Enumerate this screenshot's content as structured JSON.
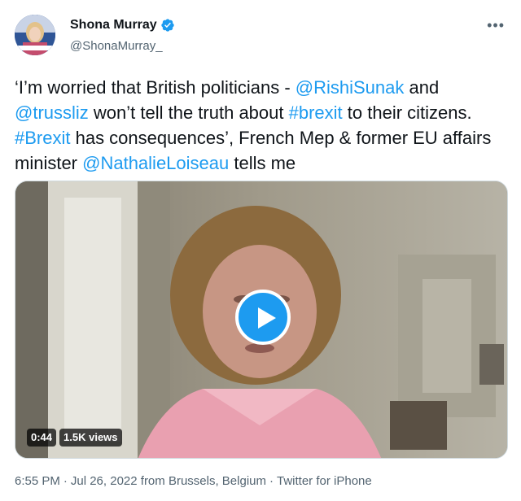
{
  "author": {
    "name": "Shona Murray",
    "handle": "@ShonaMurray_",
    "verified": true
  },
  "tweet": {
    "parts": [
      {
        "text": "‘I’m worried that British politicians - ",
        "link": false
      },
      {
        "text": "@RishiSunak",
        "link": true
      },
      {
        "text": " and ",
        "link": false
      },
      {
        "text": "@trussliz",
        "link": true
      },
      {
        "text": " won’t tell the truth about ",
        "link": false
      },
      {
        "text": "#brexit",
        "link": true
      },
      {
        "text": " to their citizens. ",
        "link": false
      },
      {
        "text": "#Brexit",
        "link": true
      },
      {
        "text": " has consequences’, French Mep & former EU affairs minister ",
        "link": false
      },
      {
        "text": "@NathalieLoiseau",
        "link": true
      },
      {
        "text": " tells me",
        "link": false
      }
    ]
  },
  "video": {
    "duration": "0:44",
    "views": "1.5K views"
  },
  "meta": {
    "time": "6:55 PM",
    "separator": "·",
    "date": "Jul 26, 2022 from Brussels, Belgium",
    "source": "Twitter for iPhone"
  },
  "colors": {
    "accent": "#1d9bf0",
    "text": "#0f1419",
    "secondary": "#536471"
  },
  "icons": [
    "avatar",
    "verified-badge-icon",
    "more-icon",
    "play-icon"
  ]
}
